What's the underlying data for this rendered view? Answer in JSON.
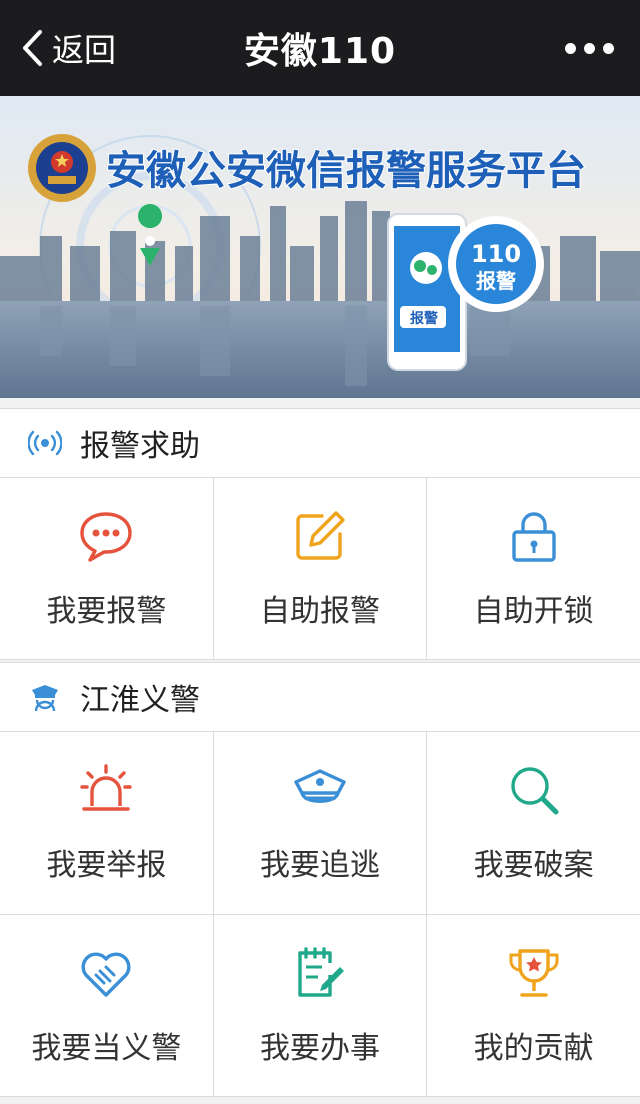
{
  "nav": {
    "back_label": "返回",
    "title": "安徽110"
  },
  "banner": {
    "title": "安徽公安微信报警服务平台",
    "badge_number": "110",
    "badge_text": "报警",
    "phone_button": "报警"
  },
  "sections": [
    {
      "title": "报警求助",
      "icon": "signal-icon",
      "items": [
        {
          "label": "我要报警",
          "icon": "chat-bubble-icon",
          "color": "#e5533c"
        },
        {
          "label": "自助报警",
          "icon": "edit-icon",
          "color": "#f0a31c"
        },
        {
          "label": "自助开锁",
          "icon": "lock-icon",
          "color": "#3b8fd6"
        }
      ]
    },
    {
      "title": "江淮义警",
      "icon": "police-officer-icon",
      "items": [
        {
          "label": "我要举报",
          "icon": "alarm-light-icon",
          "color": "#e5533c"
        },
        {
          "label": "我要追逃",
          "icon": "police-cap-icon",
          "color": "#3b8fd6"
        },
        {
          "label": "我要破案",
          "icon": "search-icon",
          "color": "#1fa88a"
        },
        {
          "label": "我要当义警",
          "icon": "handshake-heart-icon",
          "color": "#3b8fd6"
        },
        {
          "label": "我要办事",
          "icon": "document-pen-icon",
          "color": "#1fa88a"
        },
        {
          "label": "我的贡献",
          "icon": "trophy-icon",
          "color": "#f0a31c"
        }
      ]
    }
  ]
}
